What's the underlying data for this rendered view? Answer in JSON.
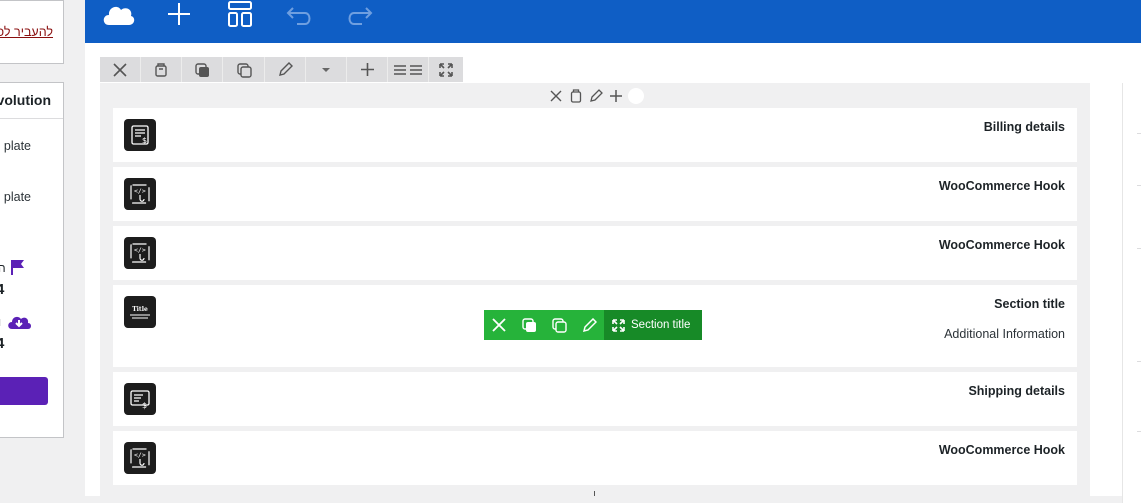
{
  "sidebar": {
    "link_text": "להעביר לפ",
    "panel_title": "volution",
    "template_label_1": "plate",
    "template_label_2": "plate",
    "stat_1_label": "ה",
    "stat_1_value": "4",
    "stat_2_label": "ו",
    "stat_2_value": "4",
    "flag_color": "#5b21b6",
    "download_color": "#5b21b6"
  },
  "topbar": {
    "color": "#0f5ec5",
    "icons": [
      "cloud-logo-icon",
      "add-icon",
      "layout-icon",
      "undo-icon",
      "redo-icon"
    ]
  },
  "section_toolbar": {
    "icons": [
      "close-icon",
      "delete-icon",
      "duplicate-icon",
      "copy-icon",
      "edit-icon",
      "chevron-down-icon",
      "add-icon",
      "columns-icon",
      "expand-icon"
    ]
  },
  "column_toolbar": {
    "icons": [
      "close-icon",
      "delete-icon",
      "edit-icon",
      "add-icon"
    ]
  },
  "widgets": [
    {
      "title": "Billing details",
      "icon": "billing-icon"
    },
    {
      "title": "WooCommerce Hook",
      "icon": "hook-icon"
    },
    {
      "title": "WooCommerce Hook",
      "icon": "hook-icon"
    },
    {
      "title": "Section title",
      "subtitle": "Additional Information",
      "icon": "title-icon",
      "icon_text": "Title"
    },
    {
      "title": "Shipping details",
      "icon": "shipping-icon"
    },
    {
      "title": "WooCommerce Hook",
      "icon": "hook-icon"
    }
  ],
  "floating_toolbar": {
    "label": "Section title",
    "color": "#26b33a"
  }
}
